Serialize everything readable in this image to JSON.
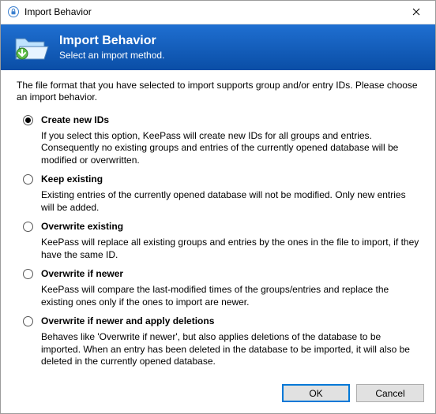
{
  "window": {
    "title": "Import Behavior"
  },
  "banner": {
    "title": "Import Behavior",
    "subtitle": "Select an import method."
  },
  "intro": "The file format that you have selected to import supports group and/or entry IDs. Please choose an import behavior.",
  "options": {
    "create": {
      "title": "Create new IDs",
      "desc": "If you select this option, KeePass will create new IDs for all groups and entries. Consequently no existing groups and entries of the currently opened database will be modified or overwritten."
    },
    "keep": {
      "title": "Keep existing",
      "desc": "Existing entries of the currently opened database will not be modified. Only new entries will be added."
    },
    "overwrite": {
      "title": "Overwrite existing",
      "desc": "KeePass will replace all existing groups and entries by the ones in the file to import, if they have the same ID."
    },
    "newer": {
      "title": "Overwrite if newer",
      "desc": "KeePass will compare the last-modified times of the groups/entries and replace the existing ones only if the ones to import are newer."
    },
    "newer_del": {
      "title": "Overwrite if newer and apply deletions",
      "desc": "Behaves like 'Overwrite if newer', but also applies deletions of the database to be imported. When an entry has been deleted in the database to be imported, it will also be deleted in the currently opened database."
    }
  },
  "buttons": {
    "ok": "OK",
    "cancel": "Cancel"
  }
}
